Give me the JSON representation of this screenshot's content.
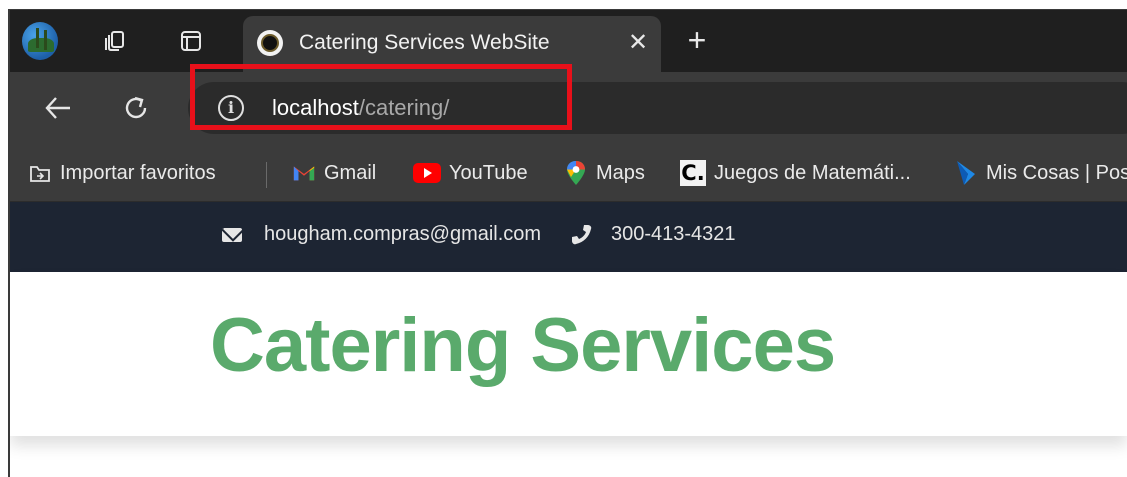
{
  "browser": {
    "tab": {
      "title": "Catering Services WebSite"
    },
    "new_tab_label": "+",
    "address": {
      "host": "localhost",
      "path": "/catering/"
    },
    "bookmarks": [
      {
        "label": "Importar favoritos",
        "icon": "import-favorites-icon"
      },
      {
        "label": "Gmail",
        "icon": "gmail-icon"
      },
      {
        "label": "YouTube",
        "icon": "youtube-icon"
      },
      {
        "label": "Maps",
        "icon": "maps-icon"
      },
      {
        "label": "Juegos de Matemáti...",
        "icon": "c-logo-icon"
      },
      {
        "label": "Mis Cosas | Pos",
        "icon": "blue-arrow-icon"
      }
    ],
    "highlight_color": "#e8101a"
  },
  "site": {
    "topbar": {
      "email": "hougham.compras@gmail.com",
      "phone": "300-413-4321"
    },
    "title": "Catering Services",
    "colors": {
      "title": "#5aaa6c",
      "topbar": "#1d2533"
    }
  }
}
